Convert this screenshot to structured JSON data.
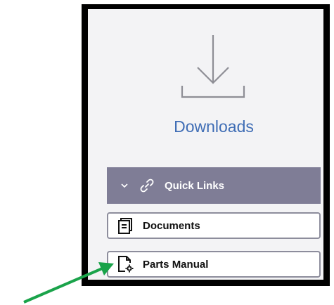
{
  "downloads": {
    "title": "Downloads",
    "icon": "download-icon"
  },
  "quick_links": {
    "label": "Quick Links",
    "expanded": true,
    "items": [
      {
        "label": "Documents",
        "icon": "documents-icon"
      },
      {
        "label": "Parts Manual",
        "icon": "parts-manual-icon"
      }
    ]
  },
  "annotation": {
    "type": "arrow",
    "color": "#1aa34a",
    "points_to": "Parts Manual"
  },
  "colors": {
    "header_bg": "#7f7d96",
    "title_blue": "#3f6db5",
    "panel_bg": "#f3f3f5",
    "frame": "#000000"
  }
}
